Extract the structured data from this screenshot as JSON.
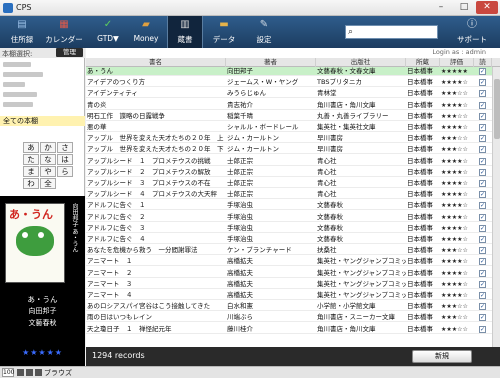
{
  "window": {
    "title": "CPS"
  },
  "toolbar": {
    "items": [
      {
        "label": "住所録"
      },
      {
        "label": "カレンダー"
      },
      {
        "label": "GTD▼"
      },
      {
        "label": "Money"
      },
      {
        "label": "蔵書"
      },
      {
        "label": "データ"
      },
      {
        "label": "設定"
      }
    ],
    "support_label": "サポート"
  },
  "sidebar": {
    "header_label": "本棚選択:",
    "manage_label": "管理",
    "all_books_label": "全ての本棚",
    "kana": [
      "あ",
      "か",
      "さ",
      "た",
      "な",
      "は",
      "ま",
      "や",
      "ら",
      "わ",
      "全"
    ]
  },
  "cover": {
    "logo": "あ・うん",
    "spine": "向田邦子 あ・うん",
    "title": "あ・うん",
    "author": "向田邦子",
    "publisher": "文藝春秋",
    "rating": "★★★★★"
  },
  "main": {
    "login_text": "Login as : admin",
    "columns": [
      "書名",
      "著者",
      "出版社",
      "所蔵",
      "評価",
      "読"
    ],
    "rows": [
      {
        "title": "あ・うん",
        "author": "向田邦子",
        "publisher": "文藝春秋・文春文庫",
        "holding": "日本橋事",
        "rating": "★★★★★",
        "read": true
      },
      {
        "title": "アイデアのつくり方",
        "author": "ジェームス・W・ヤング",
        "publisher": "TBSブリタニカ",
        "holding": "日本橋事",
        "rating": "★★★★☆",
        "read": true
      },
      {
        "title": "アイデンティティ",
        "author": "みうらじゅん",
        "publisher": "青林堂",
        "holding": "日本橋事",
        "rating": "★★★☆☆",
        "read": true
      },
      {
        "title": "青の炎",
        "author": "貴志祐介",
        "publisher": "角川書店・角川文庫",
        "holding": "日本橋事",
        "rating": "★★★★☆",
        "read": true
      },
      {
        "title": "明石工作　諜略の日露戦争",
        "author": "稲葉千晴",
        "publisher": "丸善・丸善ライブラリー",
        "holding": "日本橋事",
        "rating": "★★★☆☆",
        "read": true
      },
      {
        "title": "悪の華",
        "author": "シャルル・ボードレール",
        "publisher": "集英社・集英社文庫",
        "holding": "日本橋事",
        "rating": "★★★★☆",
        "read": true
      },
      {
        "title": "アップル　世界を変えた天才たちの２０年　上",
        "author": "ジム・カールトン",
        "publisher": "早川書房",
        "holding": "日本橋事",
        "rating": "★★★☆☆",
        "read": true
      },
      {
        "title": "アップル　世界を変えた天才たちの２０年　下",
        "author": "ジム・カールトン",
        "publisher": "早川書房",
        "holding": "日本橋事",
        "rating": "★★★☆☆",
        "read": true
      },
      {
        "title": "アップルシード　１　プロメテウスの挑戦",
        "author": "士郎正宗",
        "publisher": "青心社",
        "holding": "日本橋事",
        "rating": "★★★★☆",
        "read": true
      },
      {
        "title": "アップルシード　２　プロメテウスの解放",
        "author": "士郎正宗",
        "publisher": "青心社",
        "holding": "日本橋事",
        "rating": "★★★★☆",
        "read": true
      },
      {
        "title": "アップルシード　３　プロメテウスの不在",
        "author": "士郎正宗",
        "publisher": "青心社",
        "holding": "日本橋事",
        "rating": "★★★★☆",
        "read": true
      },
      {
        "title": "アップルシード　４　プロメテウスの大天秤",
        "author": "士郎正宗",
        "publisher": "青心社",
        "holding": "日本橋事",
        "rating": "★★★★☆",
        "read": true
      },
      {
        "title": "アドルフに告ぐ　１",
        "author": "手塚治虫",
        "publisher": "文藝春秋",
        "holding": "日本橋事",
        "rating": "★★★★☆",
        "read": true
      },
      {
        "title": "アドルフに告ぐ　２",
        "author": "手塚治虫",
        "publisher": "文藝春秋",
        "holding": "日本橋事",
        "rating": "★★★★☆",
        "read": true
      },
      {
        "title": "アドルフに告ぐ　３",
        "author": "手塚治虫",
        "publisher": "文藝春秋",
        "holding": "日本橋事",
        "rating": "★★★★☆",
        "read": true
      },
      {
        "title": "アドルフに告ぐ　４",
        "author": "手塚治虫",
        "publisher": "文藝春秋",
        "holding": "日本橋事",
        "rating": "★★★★☆",
        "read": true
      },
      {
        "title": "あなたを危機から救う　一分間謝罪法",
        "author": "ケン・ブランチャード",
        "publisher": "扶桑社",
        "holding": "日本橋事",
        "rating": "★★★☆☆",
        "read": true
      },
      {
        "title": "アニマート　１",
        "author": "高橋拡夫",
        "publisher": "集英社・ヤングジャンプコミック",
        "holding": "日本橋事",
        "rating": "★★★★☆",
        "read": true
      },
      {
        "title": "アニマート　２",
        "author": "高橋拡夫",
        "publisher": "集英社・ヤングジャンプコミック",
        "holding": "日本橋事",
        "rating": "★★★★☆",
        "read": true
      },
      {
        "title": "アニマート　３",
        "author": "高橋拡夫",
        "publisher": "集英社・ヤングジャンプコミック",
        "holding": "日本橋事",
        "rating": "★★★★☆",
        "read": true
      },
      {
        "title": "アニマート　４",
        "author": "高橋拡夫",
        "publisher": "集英社・ヤングジャンプコミック",
        "holding": "日本橋事",
        "rating": "★★★★☆",
        "read": true
      },
      {
        "title": "あのロシアスパイ宮谷はこう接触してきた",
        "author": "白水和憲",
        "publisher": "小学館・小学館文庫",
        "holding": "日本橋事",
        "rating": "★★★☆☆",
        "read": true
      },
      {
        "title": "雨の日はいつもレイン",
        "author": "川端ぶら",
        "publisher": "角川書店・スニーカー文庫",
        "holding": "日本橋事",
        "rating": "★★★☆☆",
        "read": true
      },
      {
        "title": "天之瓊日子　１　禅怪紀元年",
        "author": "藤川桂介",
        "publisher": "角川書店・角川文庫",
        "holding": "日本橋事",
        "rating": "★★★☆☆",
        "read": true
      }
    ],
    "records_text": "1294 records",
    "new_button_label": "新規"
  },
  "statusbar": {
    "zoom": "100",
    "mode": "ブラウズ"
  }
}
